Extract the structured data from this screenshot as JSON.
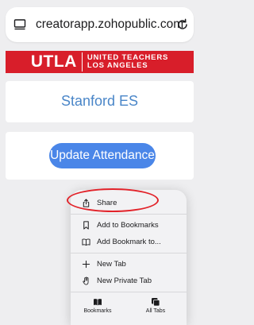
{
  "browser": {
    "url": "creatorapp.zohopublic.com"
  },
  "logo": {
    "mark": "UTLA",
    "line1": "UNITED TEACHERS",
    "line2": "LOS ANGELES"
  },
  "school": {
    "name": "Stanford ES"
  },
  "actions": {
    "update_label": "Update Attendance"
  },
  "menu": {
    "items": [
      {
        "label": "Share",
        "icon": "share-icon"
      },
      {
        "label": "Add to Bookmarks",
        "icon": "bookmark-icon"
      },
      {
        "label": "Add Bookmark to...",
        "icon": "book-icon"
      },
      {
        "label": "New Tab",
        "icon": "plus-icon"
      },
      {
        "label": "New Private Tab",
        "icon": "hand-icon"
      }
    ],
    "tabbar": [
      {
        "label": "Bookmarks",
        "icon": "book-filled-icon"
      },
      {
        "label": "All Tabs",
        "icon": "tabs-icon"
      }
    ]
  },
  "colors": {
    "brand_red": "#d81e2a",
    "button_blue": "#4a86e8",
    "school_text": "#4a86c8",
    "annotation": "#e2232a"
  }
}
